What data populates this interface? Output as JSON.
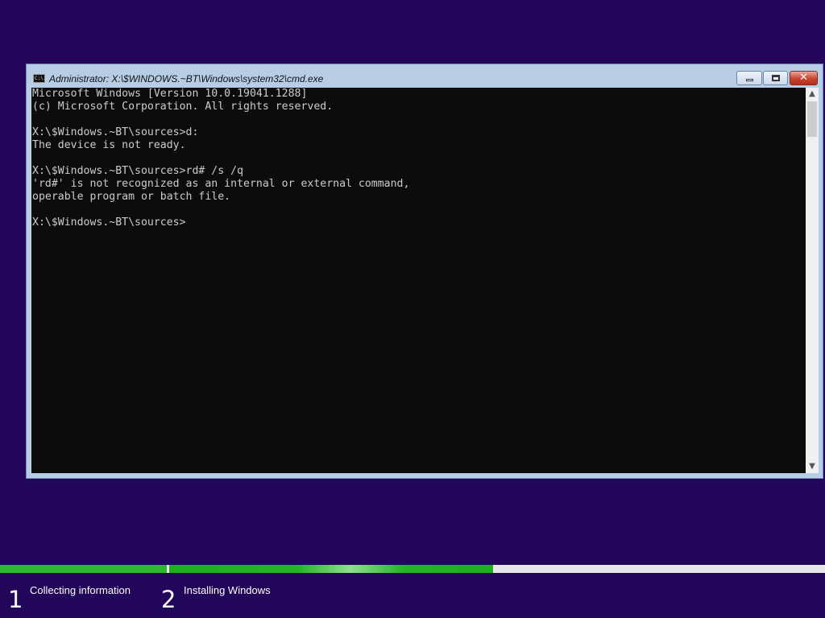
{
  "window": {
    "title": "Administrator: X:\\$WINDOWS.~BT\\Windows\\system32\\cmd.exe",
    "icon": "cmd-icon",
    "icon_text": "C:\\.",
    "controls": {
      "minimize": "minimize-icon",
      "maximize": "maximize-icon",
      "close": "close-icon",
      "close_glyph": "✕"
    }
  },
  "console": {
    "lines": [
      "Microsoft Windows [Version 10.0.19041.1288]",
      "(c) Microsoft Corporation. All rights reserved.",
      "",
      "X:\\$Windows.~BT\\sources>d:",
      "The device is not ready.",
      "",
      "X:\\$Windows.~BT\\sources>rd# /s /q",
      "'rd#' is not recognized as an internal or external command,",
      "operable program or batch file.",
      "",
      "X:\\$Windows.~BT\\sources>"
    ]
  },
  "scrollbar": {
    "up_arrow": "▲",
    "down_arrow": "▼"
  },
  "setup": {
    "steps": [
      {
        "number": "1",
        "label": "Collecting information"
      },
      {
        "number": "2",
        "label": "Installing Windows"
      }
    ],
    "progress": {
      "step1_fraction": 1.0,
      "step2_fraction": 0.49
    },
    "colors": {
      "background": "#22065a",
      "progress_green": "#2db82d",
      "console_bg": "#0c0c0c"
    }
  }
}
